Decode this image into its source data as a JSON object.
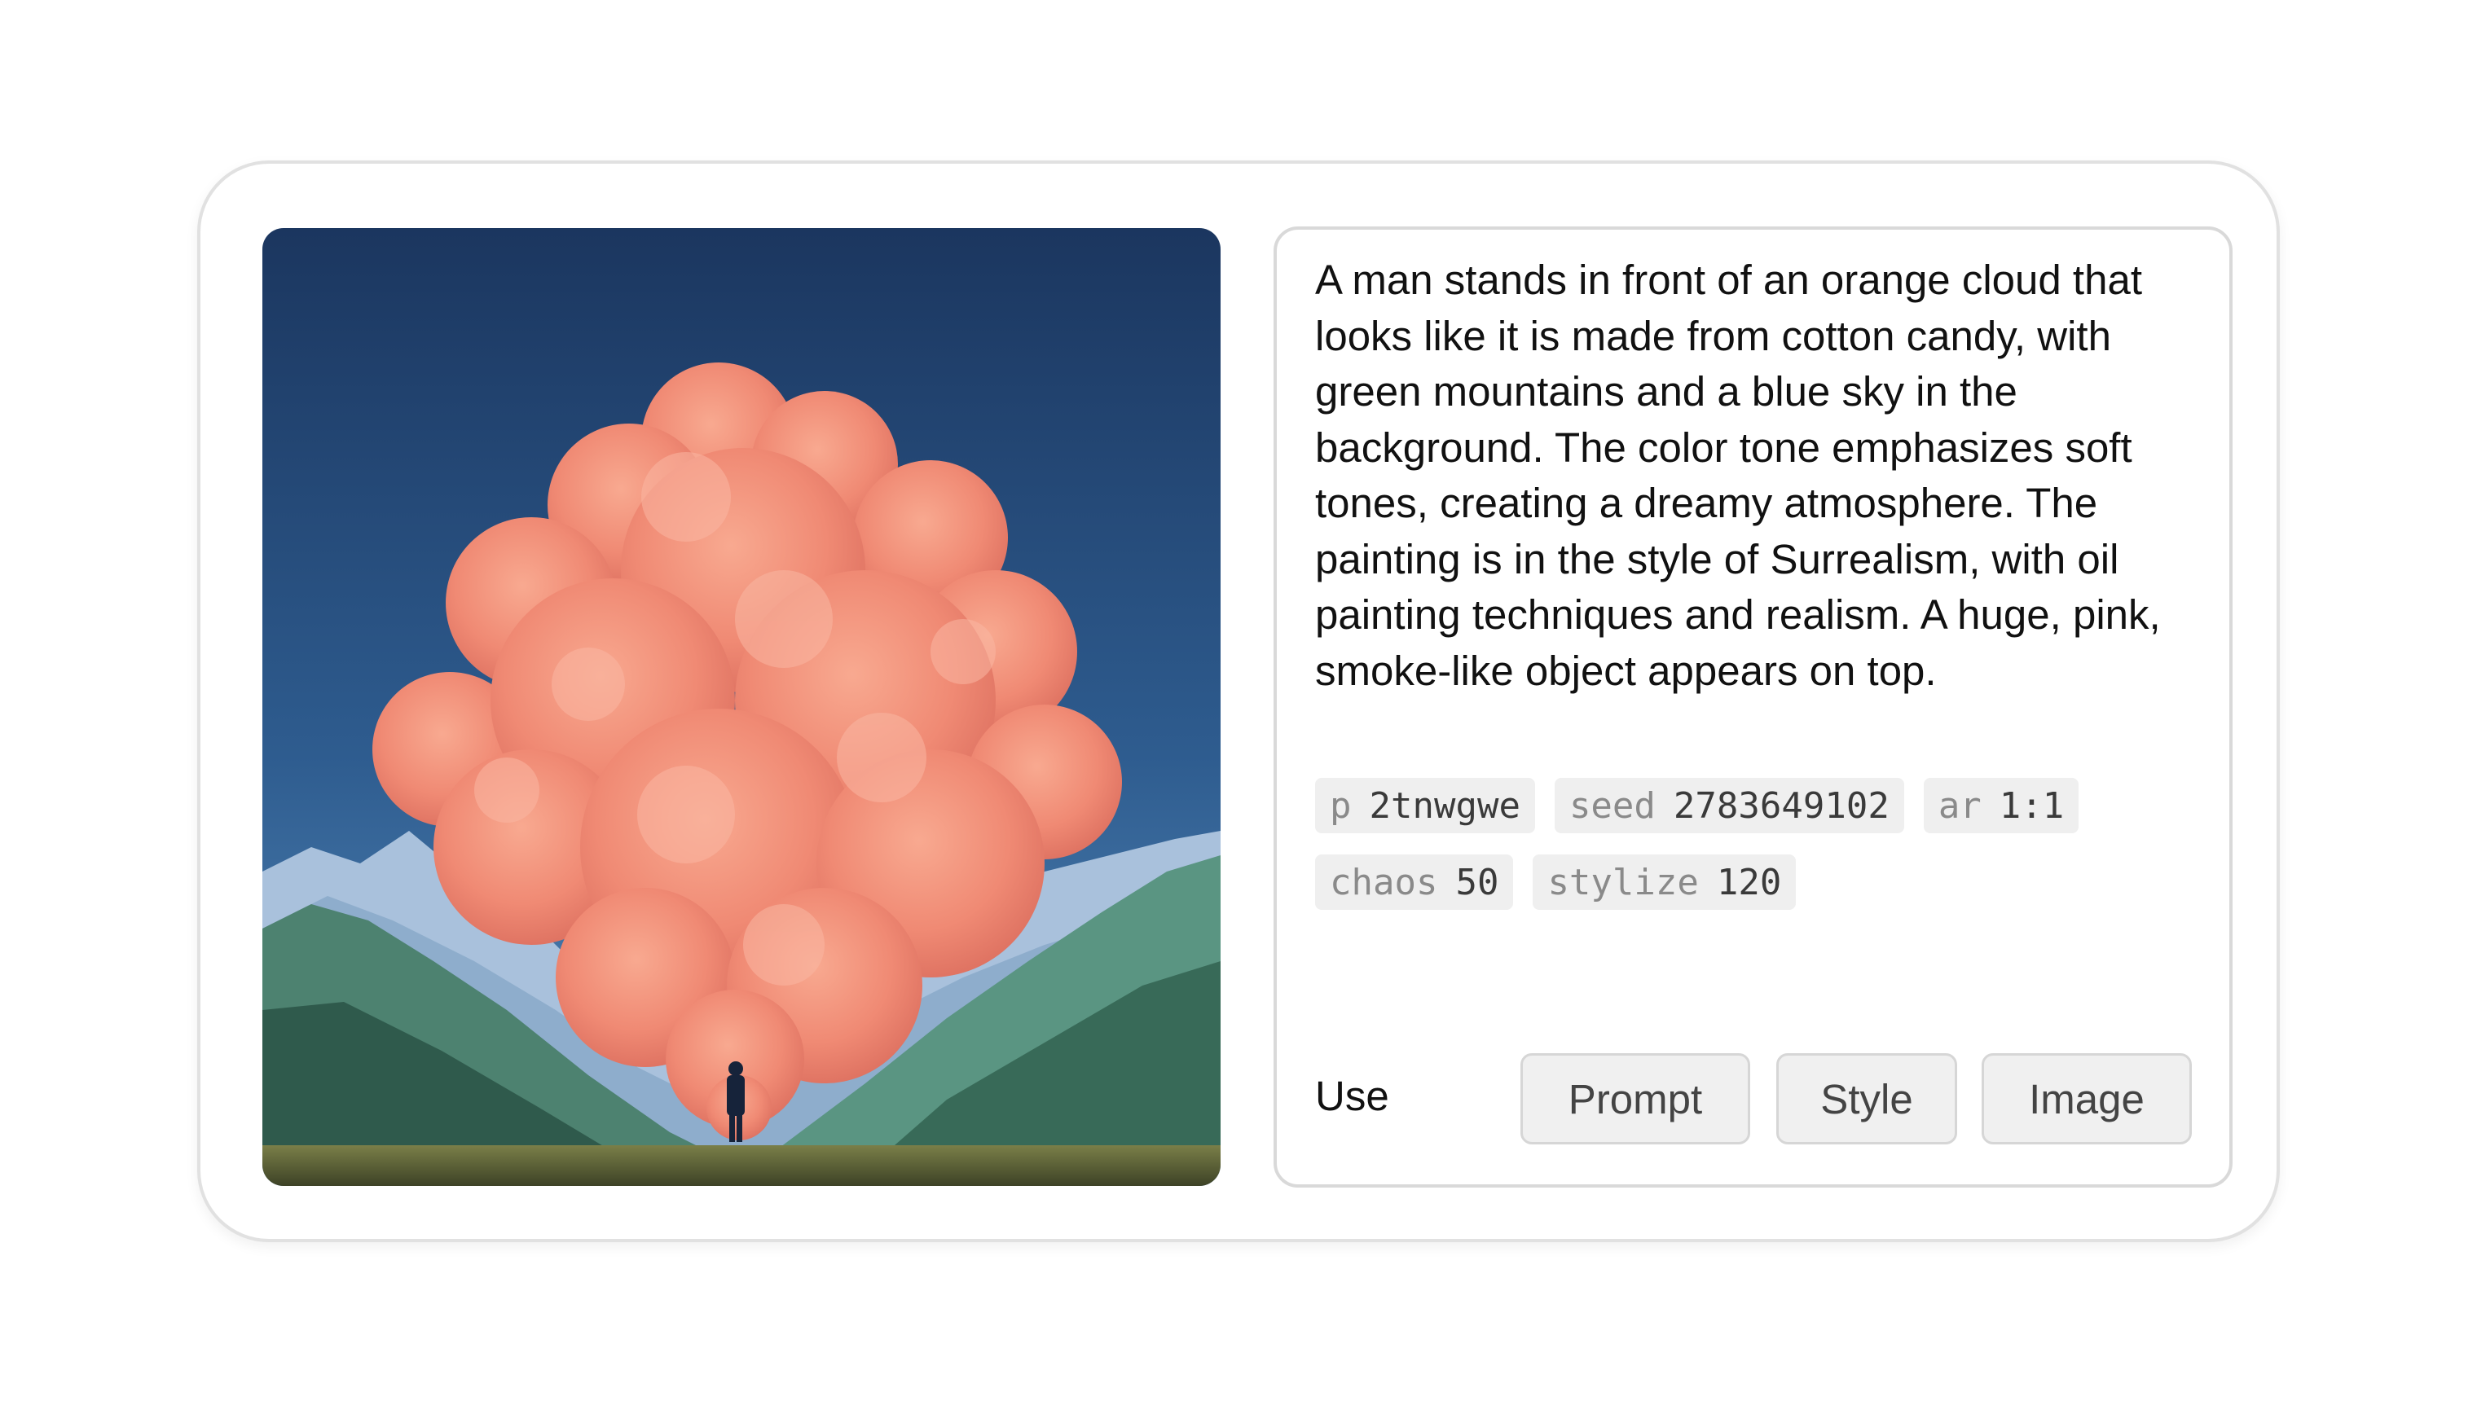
{
  "artwork": {
    "icon": "generated-image",
    "colors": {
      "sky_top": "#1d3a63",
      "sky_bottom": "#4a80b3",
      "cloud": "#f28d78",
      "cloud_highlight": "#f7ae98",
      "mountain_near": "#4a7f6a",
      "mountain_far": "#9fb9d6",
      "ground": "#5f6a3a"
    }
  },
  "prompt": {
    "text": "A man stands in front of an orange cloud that looks like it is made from cotton candy, with green mountains and a blue sky in the background. The color tone emphasizes soft tones, creating a dreamy atmosphere. The painting is in the style of Surrealism, with oil painting techniques and realism. A huge, pink, smoke-like object appears on top."
  },
  "params": [
    {
      "key": "p",
      "value": "2tnwgwe"
    },
    {
      "key": "seed",
      "value": "2783649102"
    },
    {
      "key": "ar",
      "value": "1:1"
    },
    {
      "key": "chaos",
      "value": "50"
    },
    {
      "key": "stylize",
      "value": "120"
    }
  ],
  "use": {
    "label": "Use",
    "buttons": {
      "prompt": "Prompt",
      "style": "Style",
      "image": "Image"
    }
  }
}
